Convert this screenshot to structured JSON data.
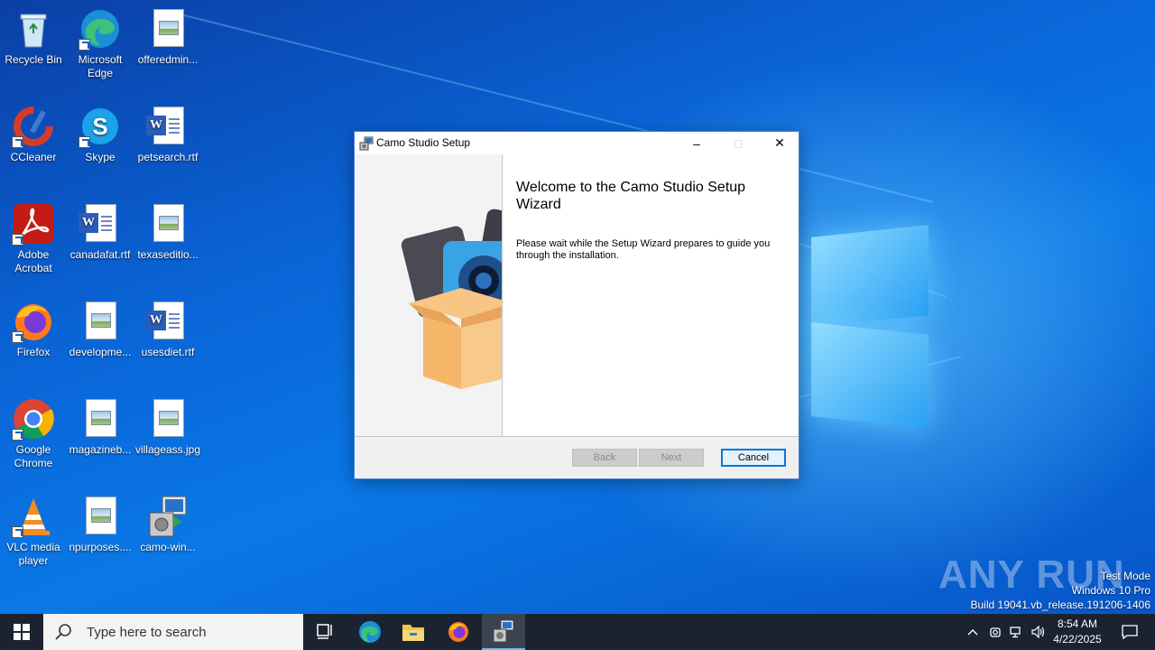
{
  "desktop": {
    "icons": [
      {
        "label": "Recycle Bin"
      },
      {
        "label": "Microsoft Edge"
      },
      {
        "label": "offeredmin..."
      },
      {
        "label": "CCleaner"
      },
      {
        "label": "Skype"
      },
      {
        "label": "petsearch.rtf"
      },
      {
        "label": "Adobe Acrobat"
      },
      {
        "label": "canadafat.rtf"
      },
      {
        "label": "texaseditio..."
      },
      {
        "label": "Firefox"
      },
      {
        "label": "developme..."
      },
      {
        "label": "usesdiet.rtf"
      },
      {
        "label": "Google Chrome"
      },
      {
        "label": "magazineb..."
      },
      {
        "label": "villageass.jpg"
      },
      {
        "label": "VLC media player"
      },
      {
        "label": "npurposes...."
      },
      {
        "label": "camo-win..."
      }
    ]
  },
  "dialog": {
    "title": "Camo Studio Setup",
    "heading": "Welcome to the Camo Studio Setup Wizard",
    "body": "Please wait while the Setup Wizard prepares to guide you through the installation.",
    "buttons": {
      "back": "Back",
      "next": "Next",
      "cancel": "Cancel"
    },
    "window_controls": {
      "minimize": "–",
      "maximize": "□",
      "close": "✕"
    }
  },
  "watermark": {
    "text": "ANY RUN"
  },
  "system_info": {
    "line1": "Test Mode",
    "line2": "Windows 10 Pro",
    "line3": "Build 19041.vb_release.191206-1406"
  },
  "taskbar": {
    "search_placeholder": "Type here to search",
    "time": "8:54 AM",
    "date": "4/22/2025"
  },
  "colors": {
    "accent": "#0078d7",
    "taskbar": "#1b2330",
    "wallpaper": "#0a64d6"
  },
  "icons": [
    "windows-start-icon",
    "search-icon",
    "task-view-icon",
    "edge-icon",
    "file-explorer-icon",
    "firefox-icon",
    "setup-installer-icon",
    "chevron-up-icon",
    "network-icon",
    "speaker-icon",
    "notification-icon"
  ]
}
